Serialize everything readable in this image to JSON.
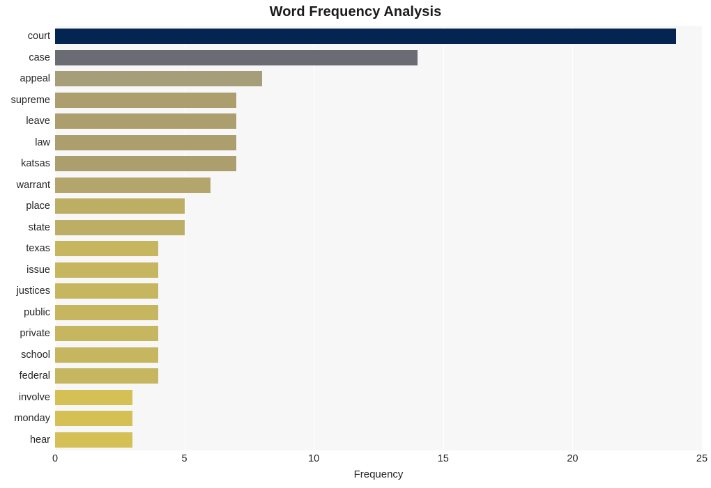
{
  "chart_data": {
    "type": "bar",
    "orientation": "horizontal",
    "title": "Word Frequency Analysis",
    "xlabel": "Frequency",
    "ylabel": "",
    "xlim": [
      0,
      25
    ],
    "xticks": [
      0,
      5,
      10,
      15,
      20,
      25
    ],
    "xtick_labels": [
      "0",
      "5",
      "10",
      "15",
      "20",
      "25"
    ],
    "grid": "vertical-white-on-light-gray",
    "legend": "none",
    "categories": [
      "court",
      "case",
      "appeal",
      "supreme",
      "leave",
      "law",
      "katsas",
      "warrant",
      "place",
      "state",
      "texas",
      "issue",
      "justices",
      "public",
      "private",
      "school",
      "federal",
      "involve",
      "monday",
      "hear"
    ],
    "values": [
      24,
      14,
      8,
      7,
      7,
      7,
      7,
      6,
      5,
      5,
      4,
      4,
      4,
      4,
      4,
      4,
      4,
      3,
      3,
      3
    ],
    "bar_colors": [
      "#042451",
      "#6b6b73",
      "#a69d79",
      "#ac9f6d",
      "#ac9f6d",
      "#ac9f6d",
      "#ac9f6d",
      "#b3a56b",
      "#bdae66",
      "#bdae66",
      "#c6b65f",
      "#c6b65f",
      "#c6b65f",
      "#c6b65f",
      "#c6b65f",
      "#c6b65f",
      "#c6b65f",
      "#d4c055",
      "#d4c055",
      "#d4c055"
    ],
    "plot_background": "#f7f7f7",
    "figure_background": "#ffffff"
  }
}
